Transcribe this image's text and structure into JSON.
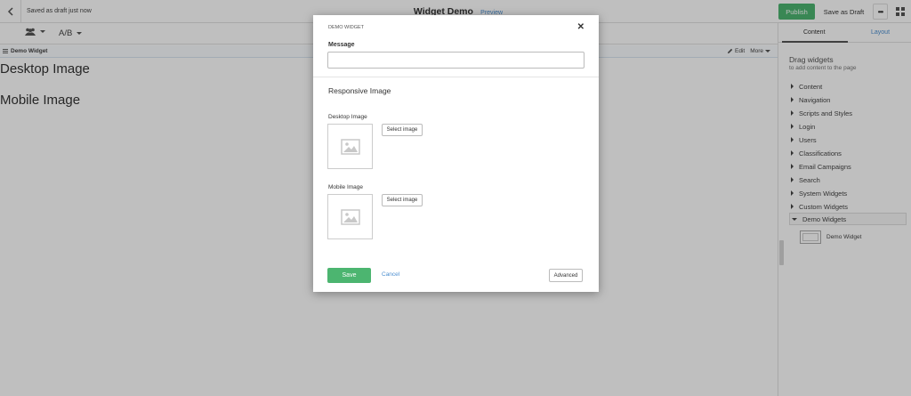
{
  "topbar": {
    "status": "Saved as draft just now",
    "title": "Widget Demo",
    "preview": "Preview",
    "publish": "Publish",
    "save_draft": "Save as Draft",
    "more": "•••"
  },
  "toolbar": {
    "ab_label": "A/B"
  },
  "canvas": {
    "widget_name": "Demo Widget",
    "edit": "Edit",
    "more": "More",
    "desktop_heading": "Desktop Image",
    "mobile_heading": "Mobile Image"
  },
  "sidebar": {
    "tabs": [
      "Content",
      "Layout"
    ],
    "heading": "Drag widgets",
    "subheading": "to add content to the page",
    "categories": [
      "Content",
      "Navigation",
      "Scripts and Styles",
      "Login",
      "Users",
      "Classifications",
      "Email Campaigns",
      "Search",
      "System Widgets",
      "Custom Widgets",
      "Demo Widgets"
    ],
    "widget_item": "Demo Widget"
  },
  "modal": {
    "title": "DEMO WIDGET",
    "message_label": "Message",
    "message_value": "",
    "section_title": "Responsive Image",
    "desktop_label": "Desktop Image",
    "mobile_label": "Mobile Image",
    "select_image": "Select image",
    "save": "Save",
    "cancel": "Cancel",
    "advanced": "Advanced"
  },
  "colors": {
    "accent_green": "#4cb570",
    "link_blue": "#4d8fd0"
  }
}
